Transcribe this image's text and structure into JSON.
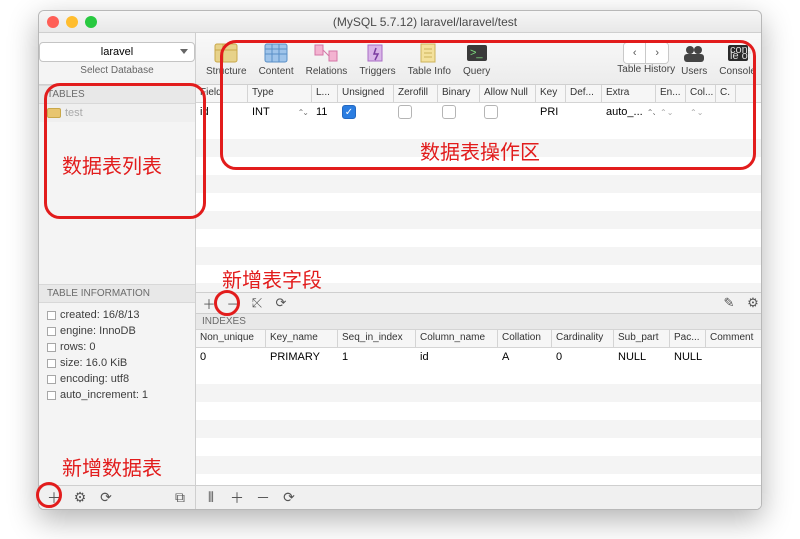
{
  "title": "(MySQL 5.7.12) laravel/laravel/test",
  "sidebar": {
    "db_selected": "laravel",
    "select_db_label": "Select Database",
    "tables_header": "TABLES",
    "table_items": [
      {
        "name": "test"
      }
    ],
    "info_header": "TABLE INFORMATION",
    "info_rows": [
      "created: 16/8/13",
      "engine: InnoDB",
      "rows: 0",
      "size: 16.0 KiB",
      "encoding: utf8",
      "auto_increment: 1"
    ]
  },
  "toolbar": {
    "structure": "Structure",
    "content": "Content",
    "relations": "Relations",
    "triggers": "Triggers",
    "tableinfo": "Table Info",
    "query": "Query",
    "tablehistory": "Table History",
    "users": "Users",
    "console": "Console"
  },
  "fields": {
    "headers": [
      "Field",
      "Type",
      "L...",
      "Unsigned",
      "Zerofill",
      "Binary",
      "Allow Null",
      "Key",
      "Def...",
      "Extra",
      "En...",
      "Col...",
      "C."
    ],
    "rows": [
      {
        "field": "id",
        "type": "INT",
        "length": "11",
        "unsigned": true,
        "zerofill": false,
        "binary": false,
        "allow_null": false,
        "key": "PRI",
        "default": "",
        "extra": "auto_..."
      }
    ]
  },
  "indexes": {
    "header": "INDEXES",
    "headers": [
      "Non_unique",
      "Key_name",
      "Seq_in_index",
      "Column_name",
      "Collation",
      "Cardinality",
      "Sub_part",
      "Pac...",
      "Comment"
    ],
    "rows": [
      {
        "non_unique": "0",
        "key_name": "PRIMARY",
        "seq": "1",
        "col": "id",
        "collation": "A",
        "card": "0",
        "sub": "NULL",
        "pac": "NULL",
        "comment": ""
      }
    ]
  },
  "annotations": {
    "list_label": "数据表列表",
    "ops_label": "数据表操作区",
    "add_field_label": "新增表字段",
    "add_table_label": "新增数据表"
  }
}
